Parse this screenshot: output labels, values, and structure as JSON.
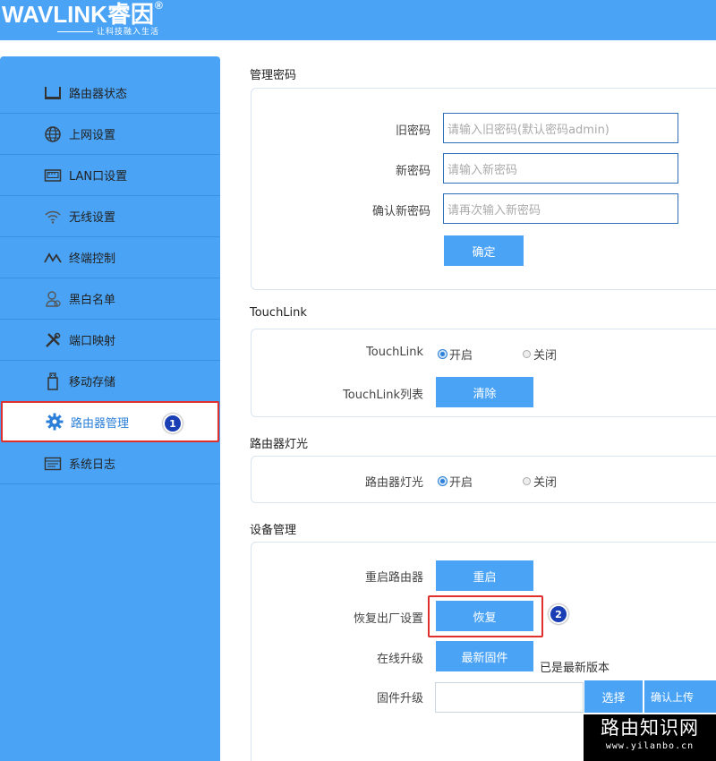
{
  "header": {
    "logo_text": "WAVLINK睿因",
    "logo_reg": "®",
    "slogan": "让科技融入生活",
    "bg_color": "#4aa3f5"
  },
  "sidebar": {
    "items": [
      {
        "label": "路由器状态",
        "icon": "router-status-icon"
      },
      {
        "label": "上网设置",
        "icon": "globe-icon"
      },
      {
        "label": "LAN口设置",
        "icon": "lan-port-icon"
      },
      {
        "label": "无线设置",
        "icon": "wifi-icon"
      },
      {
        "label": "终端控制",
        "icon": "terminal-control-icon"
      },
      {
        "label": "黑白名单",
        "icon": "user-list-icon"
      },
      {
        "label": "端口映射",
        "icon": "tools-icon"
      },
      {
        "label": "移动存储",
        "icon": "usb-storage-icon"
      },
      {
        "label": "路由器管理",
        "icon": "gear-icon",
        "active": true
      },
      {
        "label": "系统日志",
        "icon": "log-icon"
      }
    ],
    "marker": "1"
  },
  "password": {
    "title": "管理密码",
    "old_label": "旧密码",
    "old_placeholder": "请输入旧密码(默认密码admin)",
    "new_label": "新密码",
    "new_placeholder": "请输入新密码",
    "confirm_label": "确认新密码",
    "confirm_placeholder": "请再次输入新密码",
    "submit": "确定"
  },
  "touchlink": {
    "title": "TouchLink",
    "label": "TouchLink",
    "on": "开启",
    "off": "关闭",
    "state": "on",
    "list_label": "TouchLink列表",
    "clear": "清除"
  },
  "led": {
    "title": "路由器灯光",
    "label": "路由器灯光",
    "on": "开启",
    "off": "关闭",
    "state": "on"
  },
  "device": {
    "title": "设备管理",
    "reboot_label": "重启路由器",
    "reboot_btn": "重启",
    "reset_label": "恢复出厂设置",
    "reset_btn": "恢复",
    "reset_marker": "2",
    "upgrade_label": "在线升级",
    "upgrade_btn": "最新固件",
    "upgrade_status": "已是最新版本",
    "firmware_label": "固件升级",
    "firmware_value": "",
    "choose_btn": "选择",
    "upload_btn": "确认上传"
  },
  "watermark": {
    "main": "路由知识网",
    "sub": "www.yilanbo.cn"
  }
}
